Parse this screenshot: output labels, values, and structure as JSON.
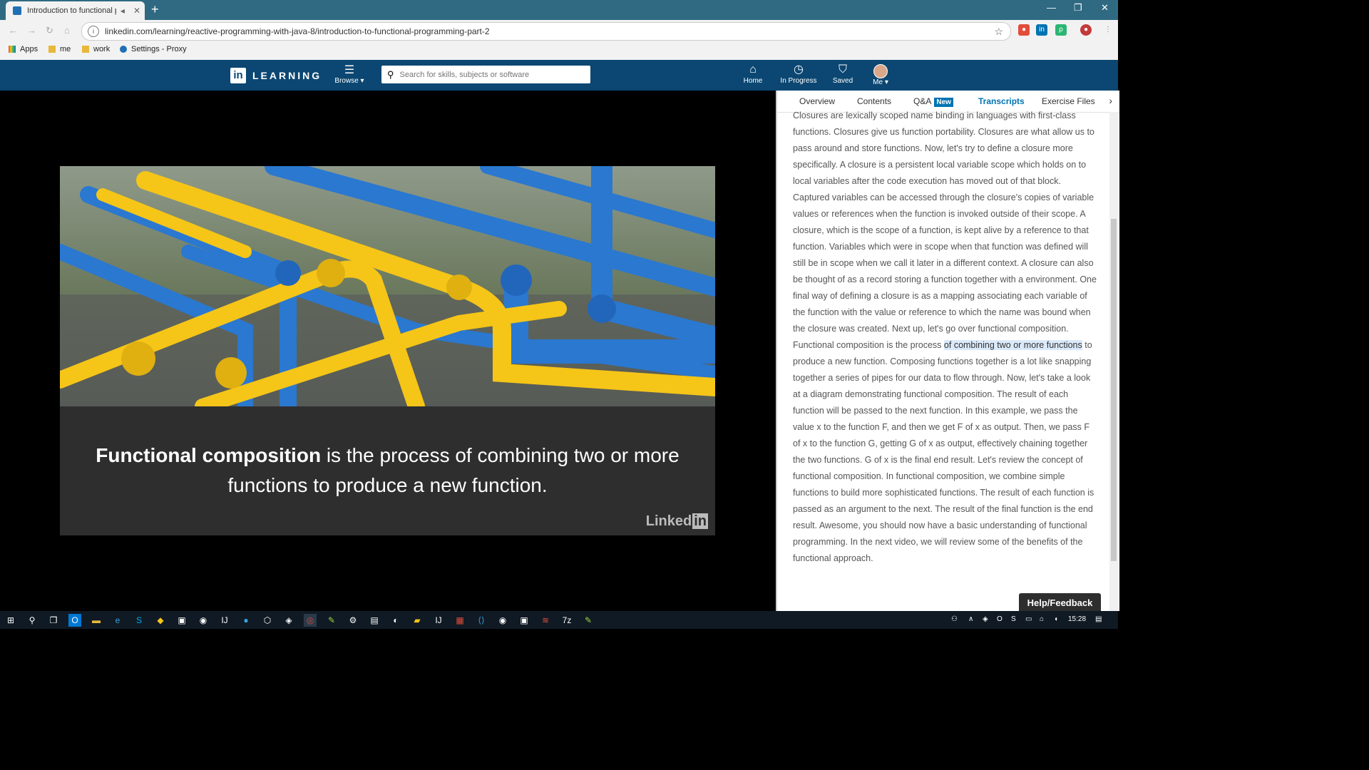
{
  "browser": {
    "tab_title": "Introduction to functional pr",
    "url": "linkedin.com/learning/reactive-programming-with-java-8/introduction-to-functional-programming-part-2",
    "bookmarks": [
      "Apps",
      "me",
      "work",
      "Settings - Proxy"
    ]
  },
  "header": {
    "logo_text": "LEARNING",
    "browse_label": "Browse",
    "search_placeholder": "Search for skills, subjects or software",
    "nav": {
      "home": "Home",
      "in_progress": "In Progress",
      "saved": "Saved",
      "me": "Me"
    }
  },
  "video": {
    "caption_bold": "Functional composition",
    "caption_rest": " is the process of combining two or more functions to produce a new function.",
    "watermark": "Linked"
  },
  "panel": {
    "tabs": {
      "overview": "Overview",
      "contents": "Contents",
      "qa": "Q&A",
      "qa_badge": "New",
      "transcripts": "Transcripts",
      "exercise": "Exercise Files"
    },
    "transcript_before": "Closures are lexically scoped name binding in languages with first-class functions. Closures give us function portability. Closures are what allow us to pass around and store functions. Now, let's try to define a closure more specifically. A closure is a persistent local variable scope which holds on to local variables after the code execution has moved out of that block. Captured variables can be accessed through the closure's copies of variable values or references when the function is invoked outside of their scope. A closure, which is the scope of a function, is kept alive by a reference to that function. Variables which were in scope when that function was defined will still be in scope when we call it later in a different context. A closure can also be thought of as a record storing a function together with a environment. One final way of defining a closure is as a mapping associating each variable of the function with the value or reference to which the name was bound when the closure was created. Next up, let's go over functional composition. Functional composition is the process ",
    "transcript_highlight": "of combining two or more functions",
    "transcript_after": " to produce a new function. Composing functions together is a lot like snapping together a series of pipes for our data to flow through. Now, let's take a look at a diagram demonstrating functional composition. The result of each function will be passed to the next function. In this example, we pass the value x to the function F, and then we get F of x as output. Then, we pass F of x to the function G, getting G of x as output, effectively chaining together the two functions. G of x is the final end result. Let's review the concept of functional composition. In functional composition, we combine simple functions to build more sophisticated functions. The result of each function is passed as an argument to the next. The result of the final function is the end result. Awesome, you should now have a basic understanding of functional programming. In the next video, we will review some of the benefits of the functional approach.",
    "help_button": "Help/Feedback"
  },
  "taskbar": {
    "time": "15:28"
  },
  "colors": {
    "brand_header": "#0b4772",
    "accent": "#0073b1",
    "pipe_blue": "#2a78d0",
    "pipe_yellow": "#f5c518"
  }
}
